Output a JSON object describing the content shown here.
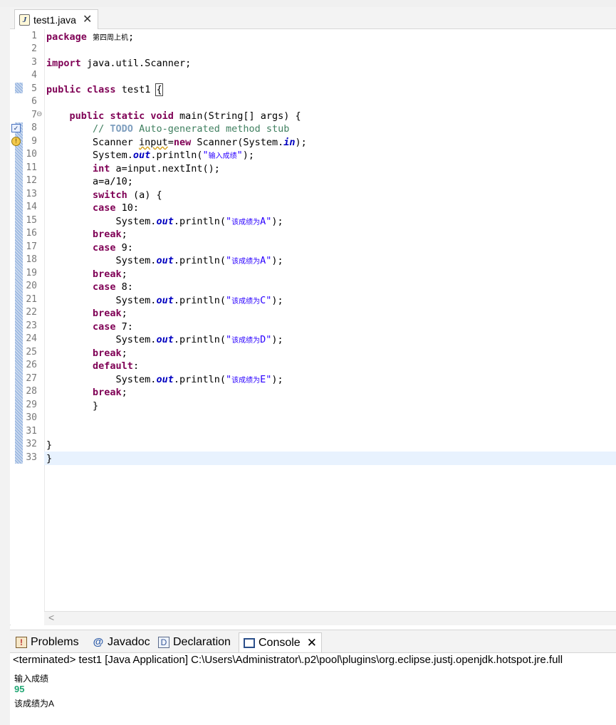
{
  "editor_tab": {
    "label": "test1.java",
    "close": "✕"
  },
  "code_lines": [
    "package 第四周上机;",
    "",
    "import java.util.Scanner;",
    "",
    "public class test1 {",
    "",
    "    public static void main(String[] args) {",
    "        // TODO Auto-generated method stub",
    "        Scanner input=new Scanner(System.in);",
    "        System.out.println(\"输入成绩\");",
    "        int a=input.nextInt();",
    "        a=a/10;",
    "        switch (a) {",
    "        case 10:",
    "            System.out.println(\"该成绩为A\");",
    "        break;",
    "        case 9:",
    "            System.out.println(\"该成绩为A\");",
    "        break;",
    "        case 8:",
    "            System.out.println(\"该成绩为C\");",
    "        break;",
    "        case 7:",
    "            System.out.println(\"该成绩为D\");",
    "        break;",
    "        default:",
    "            System.out.println(\"该成绩为E\");",
    "        break;",
    "        }",
    "",
    "",
    "}",
    "}"
  ],
  "panel_tabs": [
    {
      "label": "Problems",
      "icon": "problems-icon"
    },
    {
      "label": "Javadoc",
      "icon": "javadoc-icon"
    },
    {
      "label": "Declaration",
      "icon": "declaration-icon"
    },
    {
      "label": "Console",
      "icon": "console-icon",
      "active": true
    }
  ],
  "console": {
    "header": "<terminated> test1 [Java Application] C:\\Users\\Administrator\\.p2\\pool\\plugins\\org.eclipse.justj.openjdk.hotspot.jre.full",
    "output": [
      "输入成绩",
      "95",
      "该成绩为A"
    ]
  },
  "colors": {
    "keyword": "#7f0055",
    "comment": "#3f7f5f",
    "string": "#2a00ff",
    "field": "#0000c0",
    "console_input": "#1fa673"
  }
}
